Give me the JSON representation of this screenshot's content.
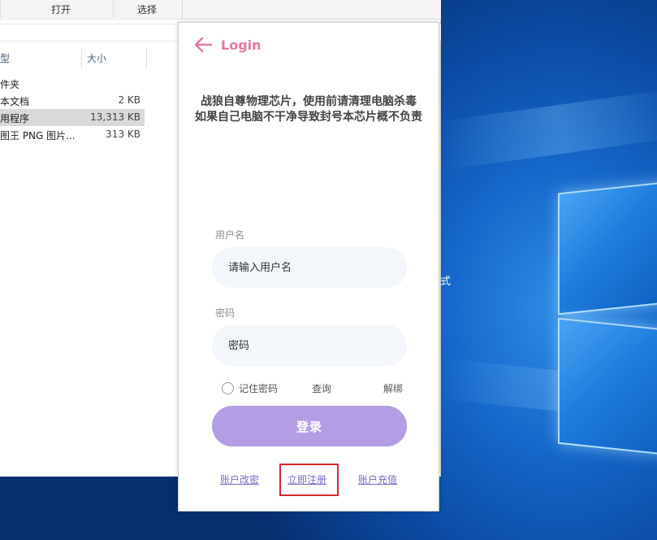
{
  "explorer": {
    "toolbar": {
      "open_label": "打开",
      "select_label": "选择"
    },
    "columns": {
      "type_label": "型",
      "size_label": "大小"
    },
    "files": [
      {
        "name": "件夹",
        "size": ""
      },
      {
        "name": "本文档",
        "size": "2 KB"
      },
      {
        "name": "用程序",
        "size": "13,313 KB",
        "selected": true
      },
      {
        "name": "图王 PNG 图片...",
        "size": "313 KB"
      }
    ]
  },
  "desktop": {
    "partial_text": "式"
  },
  "login": {
    "back_icon": "arrow-left-icon",
    "title": "Login",
    "notice_line1": "战狼自尊物理芯片，使用前请清理电脑杀毒",
    "notice_line2": "如果自己电脑不干净导致封号本芯片概不负责",
    "username_label": "用户名",
    "username_placeholder": "请输入用户名",
    "password_label": "密码",
    "password_placeholder": "密码",
    "remember_label": "记住密码",
    "query_label": "查询",
    "unbind_label": "解绑",
    "submit_label": "登录",
    "links": {
      "change_account": "账户改密",
      "register": "立即注册",
      "recharge": "账户充值"
    }
  },
  "colors": {
    "title_pink": "#e57aa0",
    "button_purple": "#b39ee6",
    "link_purple": "#7b68c8",
    "highlight_red": "#d42a2a",
    "input_bg": "#f3f6fa"
  }
}
